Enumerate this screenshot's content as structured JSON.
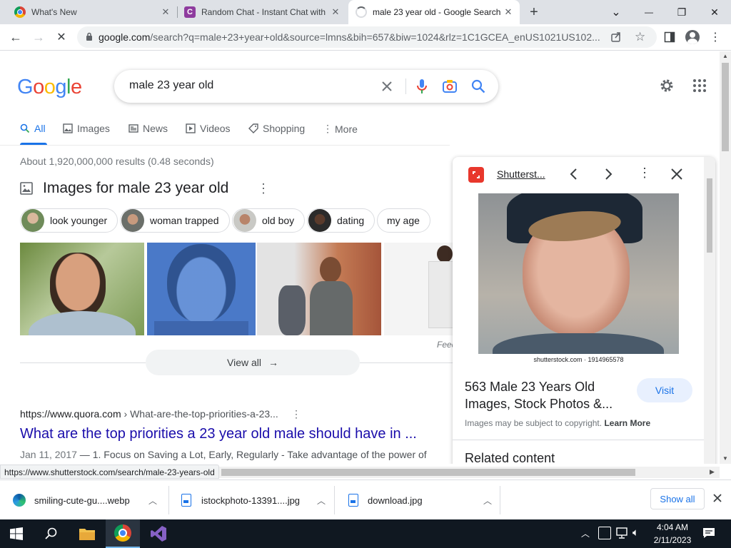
{
  "tabs": [
    {
      "title": "What's New",
      "close": "✕"
    },
    {
      "title": "Random Chat - Instant Chat with",
      "favicon_letter": "C",
      "close": "✕"
    },
    {
      "title": "male 23 year old - Google Search",
      "close": "✕"
    }
  ],
  "new_tab": "+",
  "window_controls": {
    "chevron": "⌄",
    "minimize": "—",
    "restore": "❐",
    "close": "✕"
  },
  "toolbar": {
    "back": "←",
    "forward": "→",
    "reload": "✕",
    "url_domain": "google.com",
    "url_rest": "/search?q=male+23+year+old&source=lmns&bih=657&biw=1024&rlz=1C1GCEA_enUS1021US102..."
  },
  "google": {
    "logo_letters": [
      "G",
      "o",
      "o",
      "g",
      "l",
      "e"
    ],
    "logo_colors": [
      "#4285f4",
      "#ea4335",
      "#fbbc05",
      "#4285f4",
      "#34a853",
      "#ea4335"
    ],
    "query": "male 23 year old",
    "nav": [
      {
        "label": "All",
        "icon": "search-icon"
      },
      {
        "label": "Images",
        "icon": "image-icon"
      },
      {
        "label": "News",
        "icon": "news-icon"
      },
      {
        "label": "Videos",
        "icon": "video-icon"
      },
      {
        "label": "Shopping",
        "icon": "tag-icon"
      },
      {
        "label": "More",
        "icon": "more-vert-icon"
      }
    ],
    "stats": "About 1,920,000,000 results (0.48 seconds)",
    "images_heading": "Images for male 23 year old",
    "chips": [
      "look younger",
      "woman trapped",
      "old boy",
      "dating",
      "my age"
    ],
    "feedback_label": "Feed",
    "view_all": "View all",
    "result": {
      "url_host": "https://www.quora.com",
      "url_path": " › What-are-the-top-priorities-a-23...",
      "title": "What are the top priorities a 23 year old male should have in ...",
      "date": "Jan 11, 2017",
      "snippet": " — 1. Focus on Saving a Lot, Early, Regularly - Take advantage of the power of"
    }
  },
  "panel": {
    "source": "Shutterst...",
    "credit": "shutterstock.com · 1914965578",
    "title": "563 Male 23 Years Old Images, Stock Photos &...",
    "visit": "Visit",
    "copyright": "Images may be subject to copyright.",
    "learn_more": "Learn More",
    "related": "Related content"
  },
  "status_url": "https://www.shutterstock.com/search/male-23-years-old",
  "downloads": [
    {
      "name": "smiling-cute-gu....webp"
    },
    {
      "name": "istockphoto-13391....jpg"
    },
    {
      "name": "download.jpg"
    }
  ],
  "show_all": "Show all",
  "taskbar": {
    "time": "4:04 AM",
    "date": "2/11/2023"
  }
}
